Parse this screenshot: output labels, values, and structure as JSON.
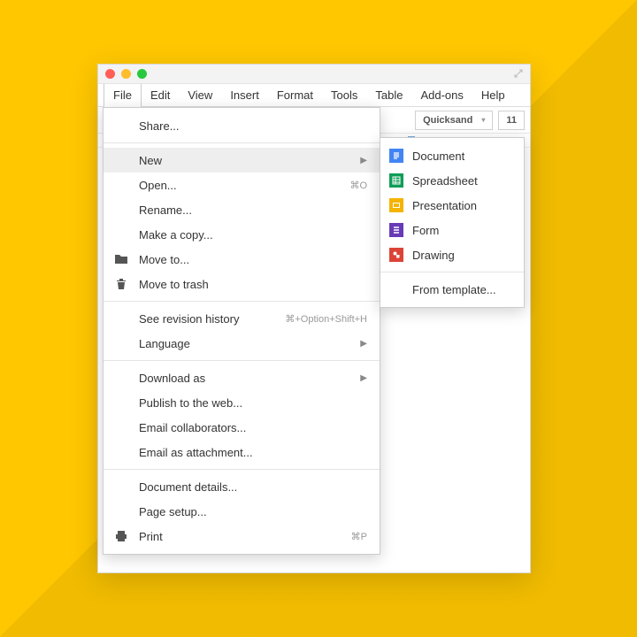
{
  "menubar": {
    "file": "File",
    "edit": "Edit",
    "view": "View",
    "insert": "Insert",
    "format": "Format",
    "tools": "Tools",
    "table": "Table",
    "addons": "Add-ons",
    "help": "Help"
  },
  "toolbar": {
    "font_name": "Quicksand",
    "font_size": "11"
  },
  "file_menu": {
    "share": "Share...",
    "new": "New",
    "open": "Open...",
    "open_shortcut": "⌘O",
    "rename": "Rename...",
    "make_copy": "Make a copy...",
    "move_to": "Move to...",
    "move_to_trash": "Move to trash",
    "revision_history": "See revision history",
    "revision_shortcut": "⌘+Option+Shift+H",
    "language": "Language",
    "download_as": "Download as",
    "publish_web": "Publish to the web...",
    "email_collab": "Email collaborators...",
    "email_attach": "Email as attachment...",
    "doc_details": "Document details...",
    "page_setup": "Page setup...",
    "print": "Print",
    "print_shortcut": "⌘P"
  },
  "new_submenu": {
    "document": "Document",
    "spreadsheet": "Spreadsheet",
    "presentation": "Presentation",
    "form": "Form",
    "drawing": "Drawing",
    "from_template": "From template..."
  }
}
